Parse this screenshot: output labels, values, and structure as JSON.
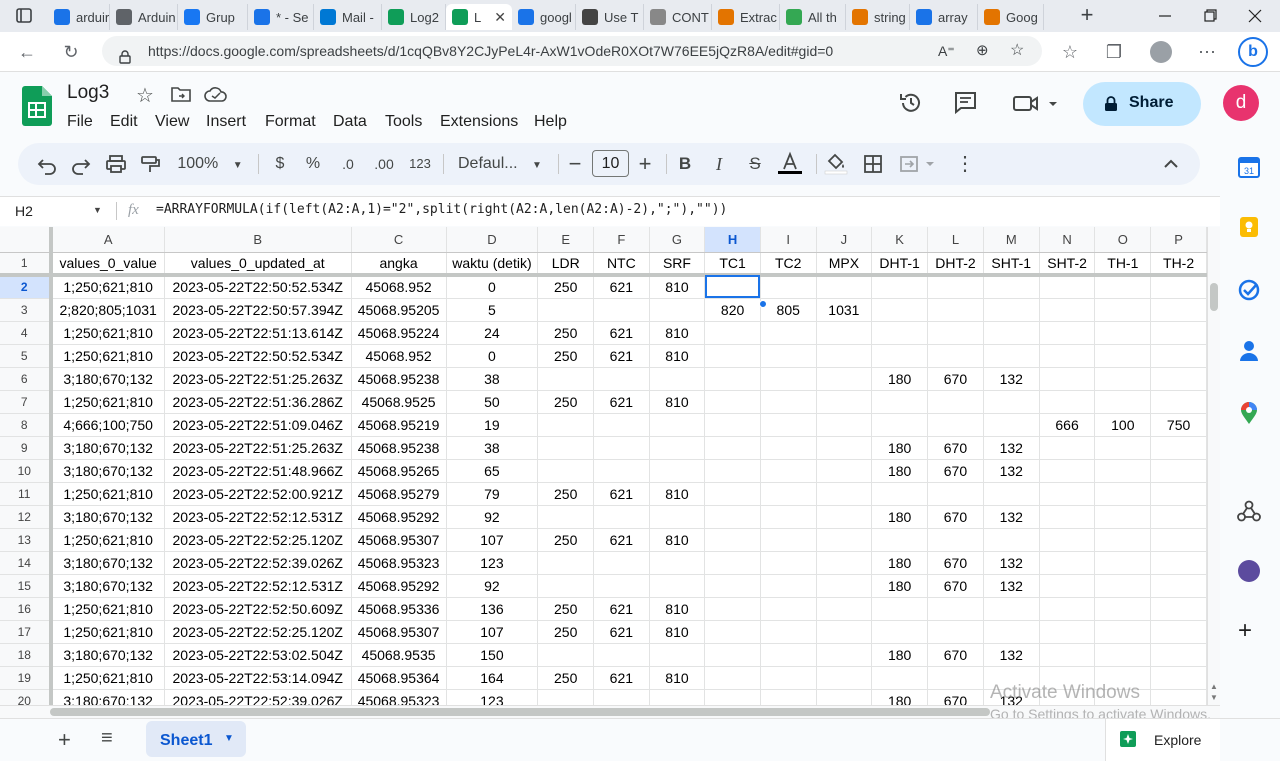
{
  "browser": {
    "tabs": [
      {
        "label": "arduir",
        "fav": "search-icon",
        "color": "#1a73e8"
      },
      {
        "label": "Arduin",
        "fav": "arduino-icon",
        "color": "#5f6368"
      },
      {
        "label": "Grup",
        "fav": "facebook-icon",
        "color": "#1877f2"
      },
      {
        "label": "* - Se",
        "fav": "search-icon",
        "color": "#1a73e8"
      },
      {
        "label": "Mail -",
        "fav": "outlook-icon",
        "color": "#0078d4"
      },
      {
        "label": "Log2",
        "fav": "sheets-icon",
        "color": "#0f9d58"
      },
      {
        "label": "L",
        "fav": "sheets-icon",
        "color": "#0f9d58"
      },
      {
        "label": "googl",
        "fav": "search-icon",
        "color": "#1a73e8"
      },
      {
        "label": "Use T",
        "fav": "grid-icon",
        "color": "#444"
      },
      {
        "label": "CONT",
        "fav": "page-icon",
        "color": "#888"
      },
      {
        "label": "Extrac",
        "fav": "link-icon",
        "color": "#e37400"
      },
      {
        "label": "All th",
        "fav": "sc-icon",
        "color": "#34a853"
      },
      {
        "label": "string",
        "fav": "link-icon",
        "color": "#e37400"
      },
      {
        "label": "array",
        "fav": "search-icon",
        "color": "#1a73e8"
      },
      {
        "label": "Goog",
        "fav": "link-icon",
        "color": "#e37400"
      }
    ],
    "active_tab_index": 6,
    "url": "https://docs.google.com/spreadsheets/d/1cqQBv8Y2CJyPeL4r-AxW1vOdeR0XOt7W76EE5jQzR8A/edit#gid=0"
  },
  "doc": {
    "title": "Log3",
    "menu": [
      "File",
      "Edit",
      "View",
      "Insert",
      "Format",
      "Data",
      "Tools",
      "Extensions",
      "Help"
    ],
    "share_label": "Share",
    "avatar_letter": "d"
  },
  "toolbar": {
    "zoom": "100%",
    "currency": "$",
    "percent": "%",
    "dec_decrease": ".0",
    "dec_increase": ".00",
    "number_format": "123",
    "font": "Defaul...",
    "font_size": "10"
  },
  "formula": {
    "cell_ref": "H2",
    "fx": "fx",
    "text": "=ARRAYFORMULA(if(left(A2:A,1)=\"2\",split(right(A2:A,len(A2:A)-2),\";\"),\"\"))"
  },
  "grid": {
    "columns": [
      "A",
      "B",
      "C",
      "D",
      "E",
      "F",
      "G",
      "H",
      "I",
      "J",
      "K",
      "L",
      "M",
      "N",
      "O",
      "P"
    ],
    "selected_col": "H",
    "selected_row": "2",
    "rows": [
      {
        "n": "1",
        "cells": [
          "values_0_value",
          "values_0_updated_at",
          "angka",
          "waktu (detik)",
          "LDR",
          "NTC",
          "SRF",
          "TC1",
          "TC2",
          "MPX",
          "DHT-1",
          "DHT-2",
          "SHT-1",
          "SHT-2",
          "TH-1",
          "TH-2"
        ]
      },
      {
        "n": "2",
        "cells": [
          "1;250;621;810",
          "2023-05-22T22:50:52.534Z",
          "45068.952",
          "0",
          "250",
          "621",
          "810",
          "",
          "",
          "",
          "",
          "",
          "",
          "",
          "",
          ""
        ]
      },
      {
        "n": "3",
        "cells": [
          "2;820;805;1031",
          "2023-05-22T22:50:57.394Z",
          "45068.95205",
          "5",
          "",
          "",
          "",
          "820",
          "805",
          "1031",
          "",
          "",
          "",
          "",
          "",
          ""
        ]
      },
      {
        "n": "4",
        "cells": [
          "1;250;621;810",
          "2023-05-22T22:51:13.614Z",
          "45068.95224",
          "24",
          "250",
          "621",
          "810",
          "",
          "",
          "",
          "",
          "",
          "",
          "",
          "",
          ""
        ]
      },
      {
        "n": "5",
        "cells": [
          "1;250;621;810",
          "2023-05-22T22:50:52.534Z",
          "45068.952",
          "0",
          "250",
          "621",
          "810",
          "",
          "",
          "",
          "",
          "",
          "",
          "",
          "",
          ""
        ]
      },
      {
        "n": "6",
        "cells": [
          "3;180;670;132",
          "2023-05-22T22:51:25.263Z",
          "45068.95238",
          "38",
          "",
          "",
          "",
          "",
          "",
          "",
          "180",
          "670",
          "132",
          "",
          "",
          ""
        ]
      },
      {
        "n": "7",
        "cells": [
          "1;250;621;810",
          "2023-05-22T22:51:36.286Z",
          "45068.9525",
          "50",
          "250",
          "621",
          "810",
          "",
          "",
          "",
          "",
          "",
          "",
          "",
          "",
          ""
        ]
      },
      {
        "n": "8",
        "cells": [
          "4;666;100;750",
          "2023-05-22T22:51:09.046Z",
          "45068.95219",
          "19",
          "",
          "",
          "",
          "",
          "",
          "",
          "",
          "",
          "",
          "666",
          "100",
          "750"
        ]
      },
      {
        "n": "9",
        "cells": [
          "3;180;670;132",
          "2023-05-22T22:51:25.263Z",
          "45068.95238",
          "38",
          "",
          "",
          "",
          "",
          "",
          "",
          "180",
          "670",
          "132",
          "",
          "",
          ""
        ]
      },
      {
        "n": "10",
        "cells": [
          "3;180;670;132",
          "2023-05-22T22:51:48.966Z",
          "45068.95265",
          "65",
          "",
          "",
          "",
          "",
          "",
          "",
          "180",
          "670",
          "132",
          "",
          "",
          ""
        ]
      },
      {
        "n": "11",
        "cells": [
          "1;250;621;810",
          "2023-05-22T22:52:00.921Z",
          "45068.95279",
          "79",
          "250",
          "621",
          "810",
          "",
          "",
          "",
          "",
          "",
          "",
          "",
          "",
          ""
        ]
      },
      {
        "n": "12",
        "cells": [
          "3;180;670;132",
          "2023-05-22T22:52:12.531Z",
          "45068.95292",
          "92",
          "",
          "",
          "",
          "",
          "",
          "",
          "180",
          "670",
          "132",
          "",
          "",
          ""
        ]
      },
      {
        "n": "13",
        "cells": [
          "1;250;621;810",
          "2023-05-22T22:52:25.120Z",
          "45068.95307",
          "107",
          "250",
          "621",
          "810",
          "",
          "",
          "",
          "",
          "",
          "",
          "",
          "",
          ""
        ]
      },
      {
        "n": "14",
        "cells": [
          "3;180;670;132",
          "2023-05-22T22:52:39.026Z",
          "45068.95323",
          "123",
          "",
          "",
          "",
          "",
          "",
          "",
          "180",
          "670",
          "132",
          "",
          "",
          ""
        ]
      },
      {
        "n": "15",
        "cells": [
          "3;180;670;132",
          "2023-05-22T22:52:12.531Z",
          "45068.95292",
          "92",
          "",
          "",
          "",
          "",
          "",
          "",
          "180",
          "670",
          "132",
          "",
          "",
          ""
        ]
      },
      {
        "n": "16",
        "cells": [
          "1;250;621;810",
          "2023-05-22T22:52:50.609Z",
          "45068.95336",
          "136",
          "250",
          "621",
          "810",
          "",
          "",
          "",
          "",
          "",
          "",
          "",
          "",
          ""
        ]
      },
      {
        "n": "17",
        "cells": [
          "1;250;621;810",
          "2023-05-22T22:52:25.120Z",
          "45068.95307",
          "107",
          "250",
          "621",
          "810",
          "",
          "",
          "",
          "",
          "",
          "",
          "",
          "",
          ""
        ]
      },
      {
        "n": "18",
        "cells": [
          "3;180;670;132",
          "2023-05-22T22:53:02.504Z",
          "45068.9535",
          "150",
          "",
          "",
          "",
          "",
          "",
          "",
          "180",
          "670",
          "132",
          "",
          "",
          ""
        ]
      },
      {
        "n": "19",
        "cells": [
          "1;250;621;810",
          "2023-05-22T22:53:14.094Z",
          "45068.95364",
          "164",
          "250",
          "621",
          "810",
          "",
          "",
          "",
          "",
          "",
          "",
          "",
          "",
          ""
        ]
      },
      {
        "n": "20",
        "cells": [
          "3;180;670;132",
          "2023-05-22T22:52:39.026Z",
          "45068.95323",
          "123",
          "",
          "",
          "",
          "",
          "",
          "",
          "180",
          "670",
          "132",
          "",
          "",
          ""
        ]
      }
    ]
  },
  "sheets": {
    "add_label": "+",
    "all_sheets_label": "≡",
    "active_sheet": "Sheet1",
    "explore_label": "Explore"
  },
  "watermark": {
    "line1": "Activate Windows",
    "line2": "Go to Settings to activate Windows."
  },
  "colors": {
    "accent": "#0b57d0",
    "share_bg": "#c2e7ff",
    "avatar_bg": "#e8336e",
    "sheets_green": "#0f9d58",
    "selection": "#1a73e8"
  }
}
